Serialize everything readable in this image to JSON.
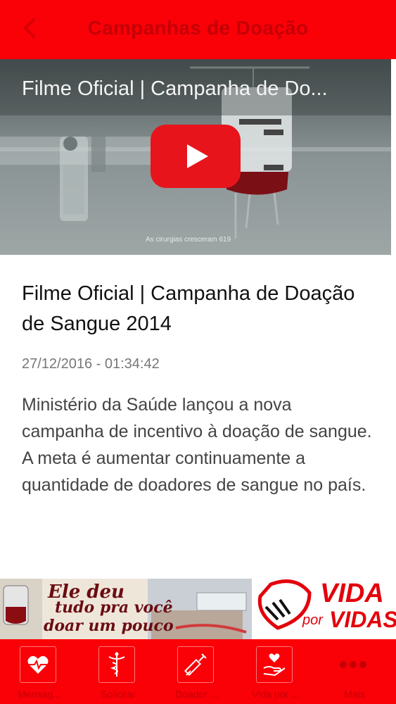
{
  "header": {
    "title": "Campanhas de Doação",
    "back_icon": "chevron-left-icon"
  },
  "video": {
    "title": "Filme Oficial | Campanha de Do...",
    "caption": "As cirurgias cresceram 619",
    "play_icon": "play-icon"
  },
  "article": {
    "title": "Filme Oficial | Campanha de Doação de Sangue 2014",
    "date": "27/12/2016 - 01:34:42",
    "description": "Ministério da Saúde lançou a nova campanha de incentivo à doação de sangue. A meta é aumentar continuamente a quantidade de doadores de sangue no país."
  },
  "banner": {
    "slogan_line1": "Ele deu",
    "slogan_line2": "tudo pra você",
    "slogan_line3": "doar um pouco",
    "logo_text_1": "VIDA",
    "logo_text_2": "por",
    "logo_text_3": "VIDAS"
  },
  "tabs": [
    {
      "label": "Mensag...",
      "icon": "heart-pulse-icon"
    },
    {
      "label": "Solicitar",
      "icon": "caduceus-icon"
    },
    {
      "label": "Doador ...",
      "icon": "syringe-icon"
    },
    {
      "label": "Vida por ...",
      "icon": "hands-heart-icon"
    },
    {
      "label": "Mais",
      "icon": "more-dots-icon"
    }
  ],
  "colors": {
    "brand_red": "#fa0007",
    "dark_red": "#c40006"
  }
}
